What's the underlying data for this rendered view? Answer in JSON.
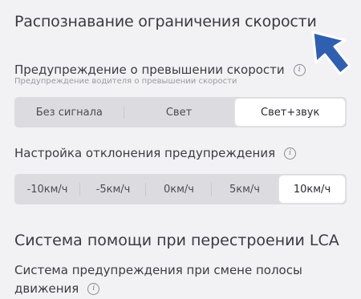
{
  "speed_limit": {
    "title": "Распознавание ограничения скорости",
    "warning": {
      "label": "Предупреждение о превышении скорости",
      "sublabel": "Предупреждение водителя о превышении скорости",
      "options": [
        "Без сигнала",
        "Свет",
        "Свет+звук"
      ],
      "selected": "Свет+звук"
    },
    "deviation": {
      "label": "Настройка отклонения предупреждения",
      "options": [
        "-10км/ч",
        "-5км/ч",
        "0км/ч",
        "5км/ч",
        "10км/ч"
      ],
      "selected": "10км/ч"
    }
  },
  "lca": {
    "title": "Система помощи при перестроении LCA",
    "sub_line1": "Система предупреждения при смене полосы",
    "sub_line2": "движения"
  },
  "icons": {
    "info": "info-icon",
    "pointer": "arrow-pointer-icon"
  },
  "colors": {
    "pointer": "#2f5fb0",
    "segment_bg": "#dcdce0",
    "segment_active": "#ffffff"
  }
}
